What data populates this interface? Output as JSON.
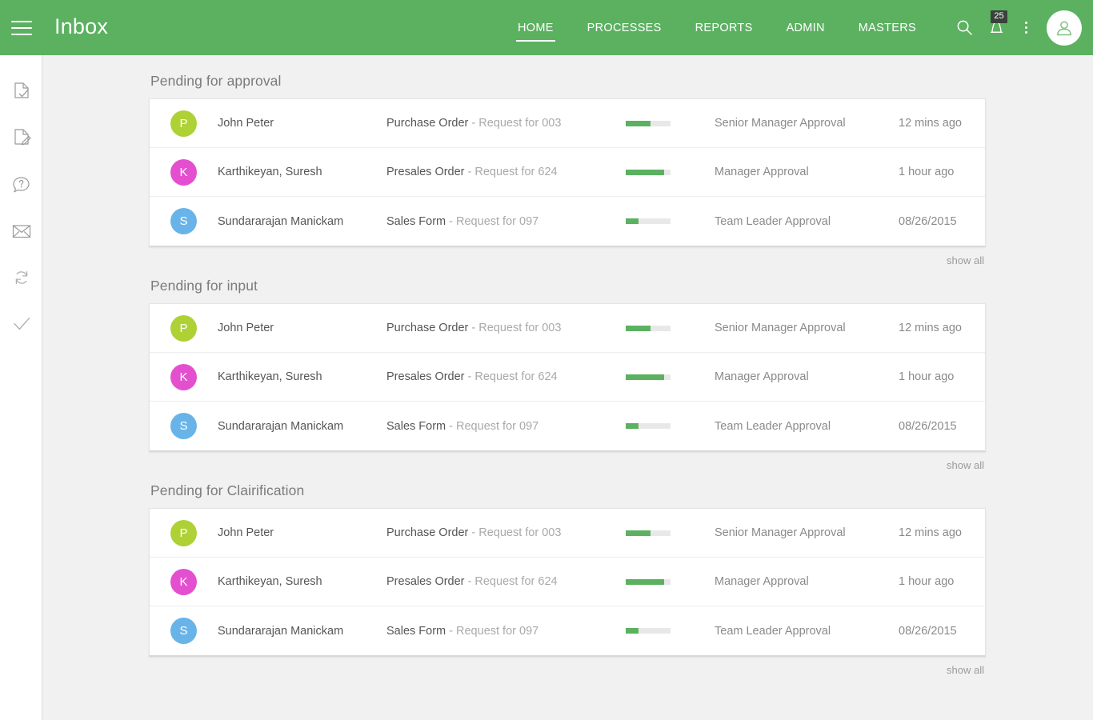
{
  "header": {
    "menu_icon": "hamburger-icon",
    "title": "Inbox",
    "brand_color": "#5cb161",
    "nav": [
      {
        "label": "HOME",
        "active": true
      },
      {
        "label": "PROCESSES",
        "active": false
      },
      {
        "label": "REPORTS",
        "active": false
      },
      {
        "label": "ADMIN",
        "active": false
      },
      {
        "label": "MASTERS",
        "active": false
      }
    ],
    "tools": {
      "search_icon": "search-icon",
      "notifications_icon": "bell-icon",
      "notifications_count": "25",
      "badge_color": "#39423a",
      "overflow_icon": "kebab-menu-icon",
      "avatar_icon": "user-avatar-icon"
    }
  },
  "rail": {
    "items": [
      {
        "icon": "document-check-icon"
      },
      {
        "icon": "document-edit-icon"
      },
      {
        "icon": "question-bubble-icon"
      },
      {
        "icon": "envelope-icon"
      },
      {
        "icon": "refresh-icon"
      },
      {
        "icon": "checkmark-icon"
      }
    ]
  },
  "main": {
    "show_all_label": "show all",
    "sections": [
      {
        "title": "Pending for approval",
        "rows": [
          {
            "initial": "P",
            "avatar_color": "#aed136",
            "name": "John Peter",
            "doc": "Purchase Order",
            "doc_sub": " - Request for 003",
            "progress": 55,
            "stage": "Senior Manager Approval",
            "time": "12 mins ago"
          },
          {
            "initial": "K",
            "avatar_color": "#e44fd0",
            "name": "Karthikeyan, Suresh",
            "doc": "Presales Order",
            "doc_sub": " - Request for 624",
            "progress": 86,
            "stage": "Manager Approval",
            "time": "1 hour ago"
          },
          {
            "initial": "S",
            "avatar_color": "#68b4e8",
            "name": "Sundararajan Manickam",
            "doc": "Sales Form",
            "doc_sub": " - Request for 097",
            "progress": 28,
            "stage": "Team Leader Approval",
            "time": "08/26/2015"
          }
        ]
      },
      {
        "title": "Pending for input",
        "rows": [
          {
            "initial": "P",
            "avatar_color": "#aed136",
            "name": "John Peter",
            "doc": "Purchase Order",
            "doc_sub": " - Request for 003",
            "progress": 55,
            "stage": "Senior Manager Approval",
            "time": "12 mins ago"
          },
          {
            "initial": "K",
            "avatar_color": "#e44fd0",
            "name": "Karthikeyan, Suresh",
            "doc": "Presales Order",
            "doc_sub": " - Request for 624",
            "progress": 86,
            "stage": "Manager Approval",
            "time": "1 hour ago"
          },
          {
            "initial": "S",
            "avatar_color": "#68b4e8",
            "name": "Sundararajan Manickam",
            "doc": "Sales Form",
            "doc_sub": " - Request for 097",
            "progress": 28,
            "stage": "Team Leader Approval",
            "time": "08/26/2015"
          }
        ]
      },
      {
        "title": "Pending for Clairification",
        "rows": [
          {
            "initial": "P",
            "avatar_color": "#aed136",
            "name": "John Peter",
            "doc": "Purchase Order",
            "doc_sub": " - Request for 003",
            "progress": 55,
            "stage": "Senior Manager Approval",
            "time": "12 mins ago"
          },
          {
            "initial": "K",
            "avatar_color": "#e44fd0",
            "name": "Karthikeyan, Suresh",
            "doc": "Presales Order",
            "doc_sub": " - Request for 624",
            "progress": 86,
            "stage": "Manager Approval",
            "time": "1 hour ago"
          },
          {
            "initial": "S",
            "avatar_color": "#68b4e8",
            "name": "Sundararajan Manickam",
            "doc": "Sales Form",
            "doc_sub": " - Request for 097",
            "progress": 28,
            "stage": "Team Leader Approval",
            "time": "08/26/2015"
          }
        ]
      }
    ]
  }
}
